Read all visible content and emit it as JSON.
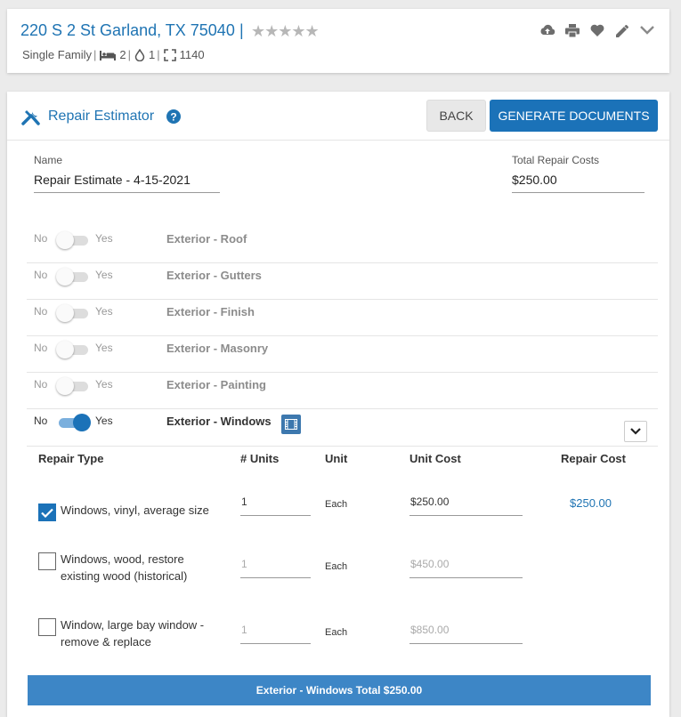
{
  "property": {
    "address": "220 S 2 St Garland, TX 75040",
    "separator": "|",
    "stars": "★★★★★",
    "type": "Single Family",
    "beds": "2",
    "baths": "1",
    "sqft": "1140"
  },
  "estimator": {
    "title": "Repair Estimator",
    "back_label": "BACK",
    "generate_label": "GENERATE DOCUMENTS",
    "name_label": "Name",
    "name_value": "Repair Estimate - 4-15-2021",
    "total_label": "Total Repair Costs",
    "total_value": "$250.00"
  },
  "categories": [
    {
      "no": "No",
      "yes": "Yes",
      "name": "Exterior - Roof",
      "on": false
    },
    {
      "no": "No",
      "yes": "Yes",
      "name": "Exterior - Gutters",
      "on": false
    },
    {
      "no": "No",
      "yes": "Yes",
      "name": "Exterior - Finish",
      "on": false
    },
    {
      "no": "No",
      "yes": "Yes",
      "name": "Exterior - Masonry",
      "on": false
    },
    {
      "no": "No",
      "yes": "Yes",
      "name": "Exterior - Painting",
      "on": false
    },
    {
      "no": "No",
      "yes": "Yes",
      "name": "Exterior - Windows",
      "on": true
    }
  ],
  "table": {
    "headers": [
      "Repair Type",
      "# Units",
      "Unit",
      "Unit Cost",
      "Repair Cost"
    ],
    "rows": [
      {
        "checked": true,
        "label": "Windows, vinyl, average size",
        "units": "1",
        "unit": "Each",
        "unit_cost": "$250.00",
        "repair_cost": "$250.00"
      },
      {
        "checked": false,
        "label": "Windows, wood, restore existing wood (historical)",
        "units": "1",
        "unit": "Each",
        "unit_cost": "$450.00",
        "repair_cost": ""
      },
      {
        "checked": false,
        "label": "Window, large bay window - remove & replace",
        "units": "1",
        "unit": "Each",
        "unit_cost": "$850.00",
        "repair_cost": ""
      }
    ]
  },
  "total_bar": "Exterior - Windows Total $250.00",
  "colors": {
    "accent": "#1b72b8",
    "link": "#1f74b3",
    "total_bar": "#3d86c6"
  }
}
